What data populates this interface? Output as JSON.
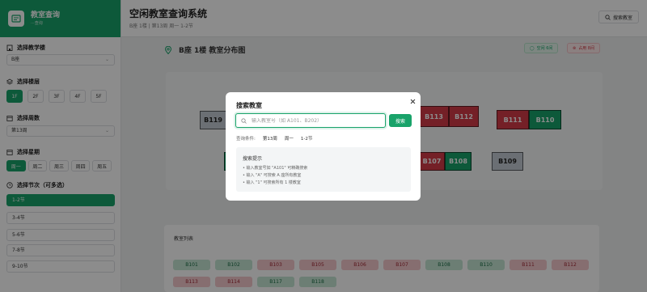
{
  "app": {
    "title": "教室查询",
    "subtitle": "···查询"
  },
  "header": {
    "title": "空闲教室查询系统",
    "subtitle": "B座 1楼 | 第13周 周一 1-2节",
    "search_button": "搜索教室"
  },
  "sidebar": {
    "building_label": "选择教学楼",
    "building_value": "B座",
    "floor_label": "选择楼层",
    "floors": [
      "1F",
      "2F",
      "3F",
      "4F",
      "5F"
    ],
    "week_label": "选择周数",
    "week_value": "第13周",
    "day_label": "选择星期",
    "days": [
      "周一",
      "周二",
      "周三",
      "周四",
      "周五"
    ],
    "period_label": "选择节次（可多选）",
    "periods": [
      "1-2节",
      "3-4节",
      "5-6节",
      "7-8节",
      "9-10节"
    ]
  },
  "distribution": {
    "title": "B座 1楼 教室分布图",
    "legend_free": "空闲 6间",
    "legend_busy": "占用 8间"
  },
  "map_rooms": [
    "B119",
    "B113",
    "B112",
    "B111",
    "B110",
    "B107",
    "B108",
    "B109"
  ],
  "room_list": {
    "title": "教室列表",
    "rooms": [
      "B101",
      "B102",
      "B103",
      "B105",
      "B106",
      "B107",
      "B108",
      "B110",
      "B111",
      "B112",
      "B113",
      "B114",
      "B117",
      "B118"
    ]
  },
  "modal": {
    "title": "搜索教室",
    "input_placeholder": "输入教室号（如 A101、B202）",
    "search_button": "搜索",
    "condition_label": "查询条件:",
    "condition_week": "第13周",
    "condition_day": "周一",
    "condition_period": "1-2节",
    "tips_title": "搜索提示",
    "tips": [
      "• 输入教室号如 \"A101\" 可精确搜索",
      "• 输入 \"A\" 可搜索 A 座所有教室",
      "• 输入 \"1\" 可搜索所有 1 楼教室"
    ]
  },
  "colors": {
    "accent": "#19a36a",
    "busy": "#d33b48",
    "free": "#19a36a",
    "other": "#c4cbd3"
  },
  "icons": [
    "building-icon",
    "layers-icon",
    "calendar-icon",
    "clock-icon",
    "search-icon",
    "location-pin-icon",
    "close-icon",
    "check-circle-icon",
    "x-circle-icon",
    "chevron-down-icon"
  ]
}
